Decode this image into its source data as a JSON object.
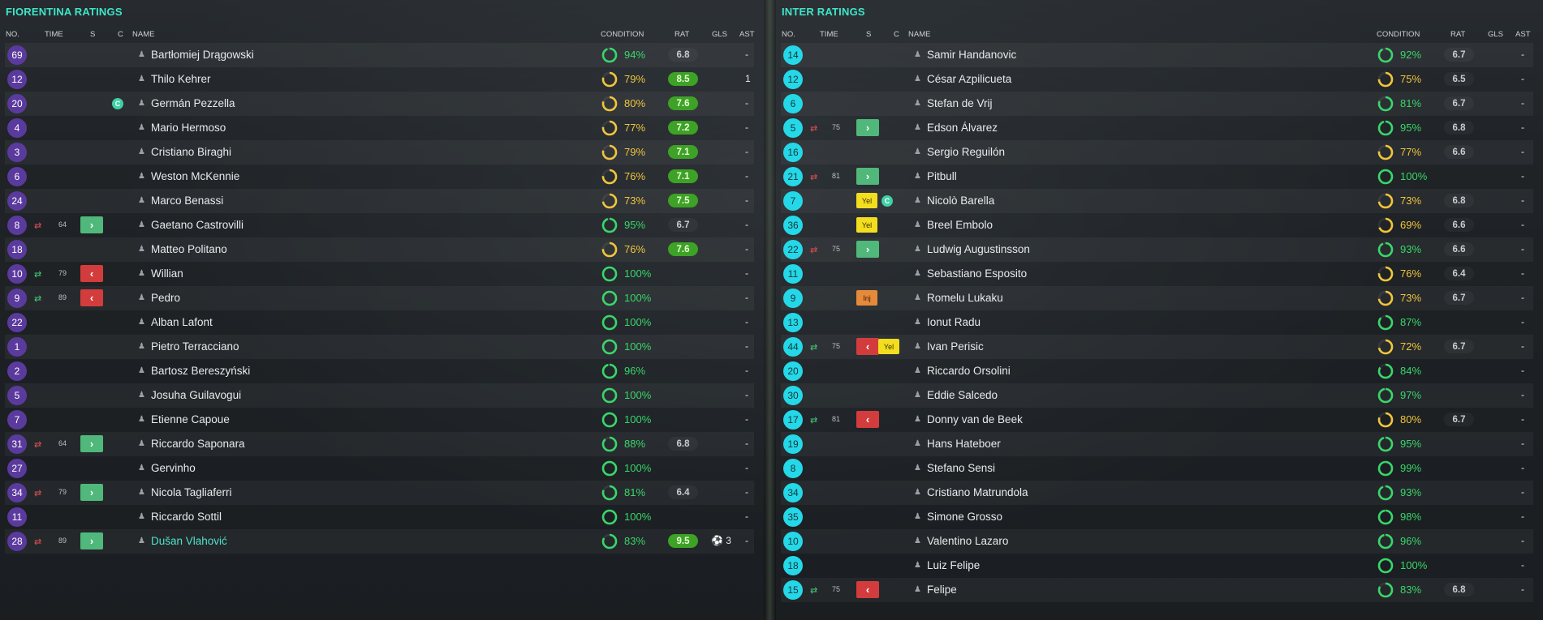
{
  "teams": [
    {
      "title": "FIORENTINA RATINGS",
      "headers": {
        "no": "NO.",
        "time": "TIME",
        "s": "S",
        "c": "C",
        "name": "NAME",
        "condition": "CONDITION",
        "rat": "RAT",
        "gls": "GLS",
        "ast": "AST"
      },
      "players": [
        {
          "no": "69",
          "name": "Bartłomiej Drągowski",
          "cond": 94,
          "condText": "94%",
          "rat": "6.8",
          "ratStyle": "plain",
          "gls": "",
          "ast": "-"
        },
        {
          "no": "12",
          "name": "Thilo Kehrer",
          "cond": 79,
          "condText": "79%",
          "rat": "8.5",
          "ratStyle": "green",
          "gls": "",
          "ast": "1"
        },
        {
          "no": "20",
          "name": "Germán Pezzella",
          "captain": "C",
          "cond": 80,
          "condText": "80%",
          "rat": "7.6",
          "ratStyle": "green",
          "gls": "",
          "ast": "-"
        },
        {
          "no": "4",
          "name": "Mario Hermoso",
          "cond": 77,
          "condText": "77%",
          "rat": "7.2",
          "ratStyle": "green",
          "gls": "",
          "ast": "-"
        },
        {
          "no": "3",
          "name": "Cristiano Biraghi",
          "cond": 79,
          "condText": "79%",
          "rat": "7.1",
          "ratStyle": "green",
          "gls": "",
          "ast": "-"
        },
        {
          "no": "6",
          "name": "Weston McKennie",
          "cond": 76,
          "condText": "76%",
          "rat": "7.1",
          "ratStyle": "green",
          "gls": "",
          "ast": "-"
        },
        {
          "no": "24",
          "name": "Marco Benassi",
          "cond": 73,
          "condText": "73%",
          "rat": "7.5",
          "ratStyle": "green",
          "gls": "",
          "ast": "-"
        },
        {
          "no": "8",
          "name": "Gaetano Castrovilli",
          "sub": "off",
          "subTime": "64",
          "subBox": "off-arrow",
          "cond": 95,
          "condText": "95%",
          "rat": "6.7",
          "ratStyle": "plain",
          "gls": "",
          "ast": "-"
        },
        {
          "no": "18",
          "name": "Matteo Politano",
          "cond": 76,
          "condText": "76%",
          "rat": "7.6",
          "ratStyle": "green",
          "gls": "",
          "ast": "-"
        },
        {
          "no": "10",
          "name": "Willian",
          "sub": "on",
          "subTime": "79",
          "cond": 100,
          "condText": "100%",
          "rat": "",
          "gls": "",
          "ast": "-"
        },
        {
          "no": "9",
          "name": "Pedro",
          "sub": "on",
          "subTime": "89",
          "cond": 100,
          "condText": "100%",
          "rat": "",
          "gls": "",
          "ast": "-"
        },
        {
          "no": "22",
          "name": "Alban Lafont",
          "cond": 100,
          "condText": "100%",
          "rat": "",
          "gls": "",
          "ast": "-"
        },
        {
          "no": "1",
          "name": "Pietro Terracciano",
          "cond": 100,
          "condText": "100%",
          "rat": "",
          "gls": "",
          "ast": "-"
        },
        {
          "no": "2",
          "name": "Bartosz Bereszyński",
          "cond": 96,
          "condText": "96%",
          "rat": "",
          "gls": "",
          "ast": "-"
        },
        {
          "no": "5",
          "name": "Josuha Guilavogui",
          "cond": 100,
          "condText": "100%",
          "rat": "",
          "gls": "",
          "ast": "-"
        },
        {
          "no": "7",
          "name": "Etienne Capoue",
          "cond": 100,
          "condText": "100%",
          "rat": "",
          "gls": "",
          "ast": "-"
        },
        {
          "no": "31",
          "name": "Riccardo Saponara",
          "sub": "off",
          "subTime": "64",
          "cond": 88,
          "condText": "88%",
          "rat": "6.8",
          "ratStyle": "plain",
          "gls": "",
          "ast": "-"
        },
        {
          "no": "27",
          "name": "Gervinho",
          "cond": 100,
          "condText": "100%",
          "rat": "",
          "gls": "",
          "ast": "-"
        },
        {
          "no": "34",
          "name": "Nicola Tagliaferri",
          "sub": "off",
          "subTime": "79",
          "cond": 81,
          "condText": "81%",
          "rat": "6.4",
          "ratStyle": "plain",
          "gls": "",
          "ast": "-"
        },
        {
          "no": "11",
          "name": "Riccardo Sottil",
          "cond": 100,
          "condText": "100%",
          "rat": "",
          "gls": "",
          "ast": "-"
        },
        {
          "no": "28",
          "name": "Dušan Vlahović",
          "highlight": true,
          "sub": "off",
          "subTime": "89",
          "cond": 83,
          "condText": "83%",
          "rat": "9.5",
          "ratStyle": "green",
          "gls": "⚽ 3",
          "ast": "-"
        }
      ]
    },
    {
      "title": "INTER RATINGS",
      "headers": {
        "no": "NO.",
        "time": "TIME",
        "s": "S",
        "c": "C",
        "name": "NAME",
        "condition": "CONDITION",
        "rat": "RAT",
        "gls": "GLS",
        "ast": "AST"
      },
      "players": [
        {
          "no": "14",
          "name": "Samir Handanovic",
          "cond": 92,
          "condText": "92%",
          "rat": "6.7",
          "ratStyle": "plain",
          "gls": "",
          "ast": "-"
        },
        {
          "no": "12",
          "name": "César Azpilicueta",
          "cond": 75,
          "condText": "75%",
          "rat": "6.5",
          "ratStyle": "plain",
          "gls": "",
          "ast": "-"
        },
        {
          "no": "6",
          "name": "Stefan de Vrij",
          "cond": 81,
          "condText": "81%",
          "rat": "6.7",
          "ratStyle": "plain",
          "gls": "",
          "ast": "-"
        },
        {
          "no": "5",
          "name": "Edson Álvarez",
          "sub": "off",
          "subTime": "75",
          "cond": 95,
          "condText": "95%",
          "rat": "6.8",
          "ratStyle": "plain",
          "gls": "",
          "ast": "-"
        },
        {
          "no": "16",
          "name": "Sergio Reguilón",
          "cond": 77,
          "condText": "77%",
          "rat": "6.6",
          "ratStyle": "plain",
          "gls": "",
          "ast": "-"
        },
        {
          "no": "21",
          "name": "Pitbull",
          "sub": "off",
          "subTime": "81",
          "cond": 100,
          "condText": "100%",
          "rat": "",
          "gls": "",
          "ast": "-"
        },
        {
          "no": "7",
          "name": "Nicolò Barella",
          "card": "Yel",
          "captain": "C",
          "cond": 73,
          "condText": "73%",
          "rat": "6.8",
          "ratStyle": "plain",
          "gls": "",
          "ast": "-"
        },
        {
          "no": "36",
          "name": "Breel Embolo",
          "card": "Yel",
          "cond": 69,
          "condText": "69%",
          "rat": "6.6",
          "ratStyle": "plain",
          "gls": "",
          "ast": "-"
        },
        {
          "no": "22",
          "name": "Ludwig Augustinsson",
          "sub": "off",
          "subTime": "75",
          "cond": 93,
          "condText": "93%",
          "rat": "6.6",
          "ratStyle": "plain",
          "gls": "",
          "ast": "-"
        },
        {
          "no": "11",
          "name": "Sebastiano Esposito",
          "cond": 76,
          "condText": "76%",
          "rat": "6.4",
          "ratStyle": "plain",
          "gls": "",
          "ast": "-"
        },
        {
          "no": "9",
          "name": "Romelu Lukaku",
          "card": "Inj",
          "cond": 73,
          "condText": "73%",
          "rat": "6.7",
          "ratStyle": "plain",
          "gls": "",
          "ast": "-"
        },
        {
          "no": "13",
          "name": "Ionut Radu",
          "cond": 87,
          "condText": "87%",
          "rat": "",
          "gls": "",
          "ast": "-"
        },
        {
          "no": "44",
          "name": "Ivan Perisic",
          "sub": "on",
          "subTime": "75",
          "card": "Yel",
          "cond": 72,
          "condText": "72%",
          "rat": "6.7",
          "ratStyle": "plain",
          "gls": "",
          "ast": "-"
        },
        {
          "no": "20",
          "name": "Riccardo Orsolini",
          "cond": 84,
          "condText": "84%",
          "rat": "",
          "gls": "",
          "ast": "-"
        },
        {
          "no": "30",
          "name": "Eddie Salcedo",
          "cond": 97,
          "condText": "97%",
          "rat": "",
          "gls": "",
          "ast": "-"
        },
        {
          "no": "17",
          "name": "Donny van de Beek",
          "sub": "on",
          "subTime": "81",
          "cond": 80,
          "condText": "80%",
          "rat": "6.7",
          "ratStyle": "plain",
          "gls": "",
          "ast": "-"
        },
        {
          "no": "19",
          "name": "Hans Hateboer",
          "cond": 95,
          "condText": "95%",
          "rat": "",
          "gls": "",
          "ast": "-"
        },
        {
          "no": "8",
          "name": "Stefano Sensi",
          "cond": 99,
          "condText": "99%",
          "rat": "",
          "gls": "",
          "ast": "-"
        },
        {
          "no": "34",
          "name": "Cristiano Matrundola",
          "cond": 93,
          "condText": "93%",
          "rat": "",
          "gls": "",
          "ast": "-"
        },
        {
          "no": "35",
          "name": "Simone Grosso",
          "cond": 98,
          "condText": "98%",
          "rat": "",
          "gls": "",
          "ast": "-"
        },
        {
          "no": "10",
          "name": "Valentino Lazaro",
          "cond": 96,
          "condText": "96%",
          "rat": "",
          "gls": "",
          "ast": "-"
        },
        {
          "no": "18",
          "name": "Luiz Felipe",
          "cond": 100,
          "condText": "100%",
          "rat": "",
          "gls": "",
          "ast": "-"
        },
        {
          "no": "15",
          "name": "Felipe",
          "sub": "on",
          "subTime": "75",
          "cond": 83,
          "condText": "83%",
          "rat": "6.8",
          "ratStyle": "plain",
          "gls": "",
          "ast": "-"
        }
      ]
    }
  ],
  "colors": {
    "accentTeal": "#3ee6c8",
    "homeBadge": "#5b3a9e",
    "awayBadge": "#25d8e8",
    "condGreen": "#39d66a",
    "condYellow": "#f0c53c",
    "ratGreen": "#3da226",
    "subOnGreen": "#4fb87a",
    "subOffRed": "#d33c3c",
    "yellowCard": "#f2dd1f",
    "injury": "#e58a3a"
  },
  "icons": {
    "sub-on": "sub-on-arrows-icon",
    "sub-off": "sub-off-arrows-icon",
    "player": "player-silhouette-icon",
    "goal": "football-icon"
  }
}
